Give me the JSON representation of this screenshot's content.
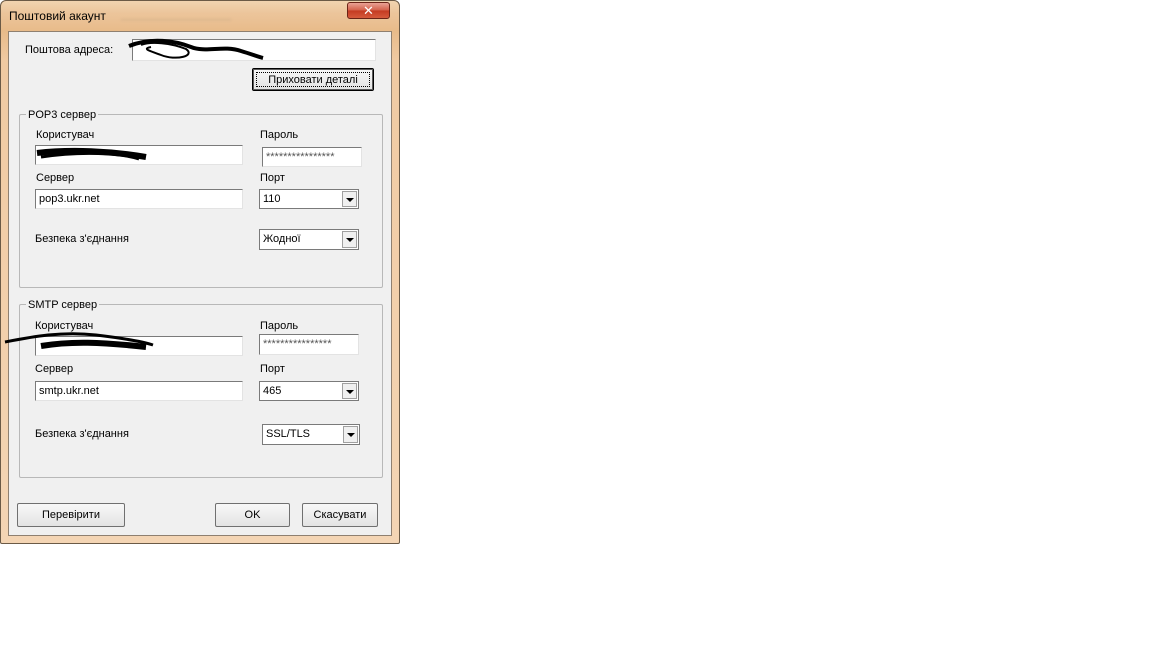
{
  "window": {
    "title": "Поштовий акаунт",
    "close_glyph": "✕"
  },
  "account": {
    "email_label": "Поштова адреса:",
    "hide_details_label": "Приховати деталі"
  },
  "pop3": {
    "legend": "POP3 сервер",
    "user_label": "Користувач",
    "password_label": "Пароль",
    "password_value": "****************",
    "server_label": "Сервер",
    "server_value": "pop3.ukr.net",
    "port_label": "Порт",
    "port_value": "110",
    "security_label": "Безпека з'єднання",
    "security_value": "Жодної"
  },
  "smtp": {
    "legend": "SMTP сервер",
    "user_label": "Користувач",
    "password_label": "Пароль",
    "password_value": "****************",
    "server_label": "Сервер",
    "server_value": "smtp.ukr.net",
    "port_label": "Порт",
    "port_value": "465",
    "security_label": "Безпека з'єднання",
    "security_value": "SSL/TLS"
  },
  "buttons": {
    "verify_label": "Перевірити",
    "ok_label": "OK",
    "cancel_label": "Скасувати"
  }
}
